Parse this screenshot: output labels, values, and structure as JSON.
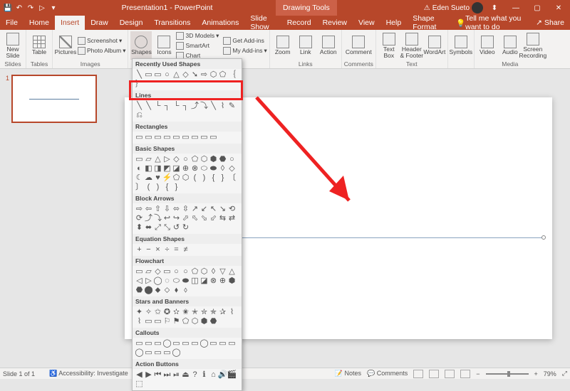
{
  "title": "Presentation1 - PowerPoint",
  "tool_tab": "Drawing Tools",
  "user": {
    "warn_icon": "⚠",
    "name": "Eden Sueto"
  },
  "window": {
    "min": "—",
    "max": "▢",
    "close": "✕",
    "ribbon_opts": "⬍"
  },
  "qat": {
    "save": "💾",
    "undo": "↶",
    "redo": "↷",
    "start": "▷",
    "more": "▾"
  },
  "tabs": [
    "File",
    "Home",
    "Insert",
    "Draw",
    "Design",
    "Transitions",
    "Animations",
    "Slide Show",
    "Record",
    "Review",
    "View",
    "Help",
    "Shape Format"
  ],
  "tabs_active_index": 2,
  "tellme": "Tell me what you want to do",
  "share": "Share",
  "ribbon": {
    "slides": {
      "new_slide": "New\nSlide",
      "label": "Slides",
      "caret": "▾"
    },
    "tables": {
      "table": "Table",
      "label": "Tables",
      "caret": "▾"
    },
    "images": {
      "pictures": "Pictures",
      "screenshot": "Screenshot",
      "photo_album": "Photo Album",
      "label": "Images",
      "caret": "▾"
    },
    "illus": {
      "shapes": "Shapes",
      "icons": "Icons",
      "d3d": "3D Models",
      "smartart": "SmartArt",
      "chart": "Chart",
      "caret": "▾"
    },
    "addins": {
      "get": "Get Add-ins",
      "my": "My Add-ins",
      "caret": "▾"
    },
    "links": {
      "zoom": "Zoom",
      "link": "Link",
      "action": "Action",
      "label": "Links",
      "caret": "▾"
    },
    "comments": {
      "comment": "Comment",
      "label": "Comments"
    },
    "text": {
      "textbox": "Text\nBox",
      "headerfooter": "Header\n& Footer",
      "wordart": "WordArt",
      "label": "Text",
      "caret": "▾"
    },
    "symbols": {
      "symbols": "Symbols",
      "label": "",
      "caret": "▾"
    },
    "media": {
      "video": "Video",
      "audio": "Audio",
      "screenrec": "Screen\nRecording",
      "label": "Media",
      "caret": "▾"
    }
  },
  "shapes_dropdown": {
    "recent": {
      "label": "Recently Used Shapes",
      "items": [
        "╲",
        "▭",
        "▭",
        "○",
        "△",
        "◇",
        "➘",
        "⇨",
        "⬡",
        "⬠",
        "｛",
        "｝"
      ]
    },
    "lines": {
      "label": "Lines",
      "items": [
        "╲",
        "╲",
        "└",
        "┐",
        "└",
        "┐",
        "⤴",
        "⤵",
        "╲",
        "⌇",
        "✎",
        "⎌"
      ]
    },
    "rectangles": {
      "label": "Rectangles",
      "items": [
        "▭",
        "▭",
        "▭",
        "▭",
        "▭",
        "▭",
        "▭",
        "▭",
        "▭"
      ]
    },
    "basic": {
      "label": "Basic Shapes",
      "items": [
        "▭",
        "▱",
        "△",
        "▷",
        "◇",
        "○",
        "⬠",
        "⬡",
        "⬢",
        "⬣",
        "○",
        "◐",
        "◧",
        "◨",
        "◩",
        "◪",
        "⊕",
        "⊗",
        "⬭",
        "⬬",
        "◊",
        "◇",
        "☾",
        "☁",
        "♥",
        "⚡",
        "⬠",
        "⬡",
        "(",
        ")",
        "{",
        "}",
        "〔",
        "〕",
        "(",
        ")",
        "{",
        "}"
      ]
    },
    "block_arrows": {
      "label": "Block Arrows",
      "items": [
        "⇨",
        "⇦",
        "⇧",
        "⇩",
        "⬄",
        "⇳",
        "↗",
        "↙",
        "↖",
        "↘",
        "⟲",
        "⟳",
        "⤴",
        "⤵",
        "↩",
        "↪",
        "⬀",
        "⬁",
        "⬂",
        "⬃",
        "⇆",
        "⇄",
        "⬍",
        "⬌",
        "⤢",
        "⤡",
        "↺",
        "↻"
      ]
    },
    "eq": {
      "label": "Equation Shapes",
      "items": [
        "+",
        "−",
        "×",
        "÷",
        "=",
        "≠"
      ]
    },
    "flow": {
      "label": "Flowchart",
      "items": [
        "▭",
        "▱",
        "◇",
        "▭",
        "○",
        "○",
        "⬠",
        "⬡",
        "◊",
        "▽",
        "△",
        "◁",
        "▷",
        "◯",
        "◌",
        "⬭",
        "⬬",
        "◫",
        "◪",
        "⊗",
        "⊕",
        "⬢",
        "⬣",
        "⬤",
        "⬥",
        "⬦",
        "⬧",
        "⬨"
      ]
    },
    "stars": {
      "label": "Stars and Banners",
      "items": [
        "✦",
        "✧",
        "✩",
        "✪",
        "✫",
        "✬",
        "✭",
        "✮",
        "✯",
        "✰",
        "⌇",
        "⌇",
        "▭",
        "▭",
        "⚐",
        "⚑",
        "⬠",
        "⬡",
        "⬢",
        "⬣"
      ]
    },
    "callouts": {
      "label": "Callouts",
      "items": [
        "▭",
        "▭",
        "▭",
        "◯",
        "▭",
        "▭",
        "▭",
        "◯",
        "▭",
        "▭",
        "▭",
        "◯",
        "▭",
        "▭",
        "▭",
        "◯"
      ]
    },
    "actions": {
      "label": "Action Buttons",
      "items": [
        "◀",
        "▶",
        "⏮",
        "⏭",
        "⏯",
        "⏏",
        "?",
        "ℹ",
        "⌂",
        "🔊",
        "🎬",
        "⬚"
      ]
    }
  },
  "status": {
    "slide_of": "Slide 1 of 1",
    "lang": "",
    "accessibility": "Accessibility: Investigate",
    "notes": "Notes",
    "comments": "Comments",
    "zoom": "79%",
    "fit": "⤢"
  }
}
